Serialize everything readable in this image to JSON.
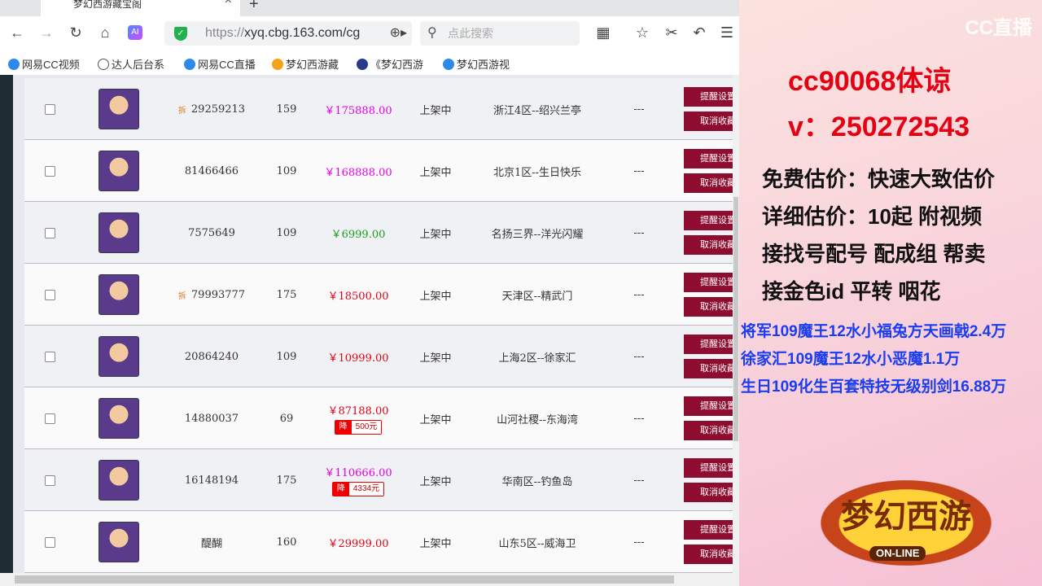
{
  "browser": {
    "tab_title": "梦幻西游藏宝阁",
    "url_prefix": "https://",
    "url_host": "xyq.cbg.163.com/cg",
    "search_placeholder": "点此搜索",
    "bookmarks": [
      "网易CC视频",
      "达人后台系",
      "网易CC直播",
      "梦幻西游藏",
      "《梦幻西游",
      "梦幻西游视"
    ]
  },
  "table": {
    "remind_label": "提醒设置",
    "cancel_label": "取消收藏",
    "drop_label": "降",
    "split_label": "拆",
    "rows": [
      {
        "split": true,
        "id": "29259213",
        "level": "159",
        "price": "￥175888.00",
        "price_color": "#e600e6",
        "status": "上架中",
        "server": "浙江4区--绍兴兰亭",
        "extra": "---"
      },
      {
        "split": false,
        "id": "81466466",
        "level": "109",
        "price": "￥168888.00",
        "price_color": "#e600e6",
        "status": "上架中",
        "server": "北京1区--生日快乐",
        "extra": "---"
      },
      {
        "split": false,
        "id": "7575649",
        "level": "109",
        "price": "￥6999.00",
        "price_color": "#1aa01a",
        "status": "上架中",
        "server": "名扬三界--洋光闪耀",
        "extra": "---"
      },
      {
        "split": true,
        "id": "79993777",
        "level": "175",
        "price": "￥18500.00",
        "price_color": "#e50012",
        "status": "上架中",
        "server": "天津区--精武门",
        "extra": "---"
      },
      {
        "split": false,
        "id": "20864240",
        "level": "109",
        "price": "￥10999.00",
        "price_color": "#e50012",
        "status": "上架中",
        "server": "上海2区--徐家汇",
        "extra": "---"
      },
      {
        "split": false,
        "id": "14880037",
        "level": "69",
        "price": "￥87188.00",
        "price_color": "#e50012",
        "drop": "500元",
        "status": "上架中",
        "server": "山河社稷--东海湾",
        "extra": "---"
      },
      {
        "split": false,
        "id": "16148194",
        "level": "175",
        "price": "￥110666.00",
        "price_color": "#e600e6",
        "drop": "4334元",
        "status": "上架中",
        "server": "华南区--钓鱼岛",
        "extra": "---"
      },
      {
        "split": false,
        "id": "醍醐",
        "level": "160",
        "price": "￥29999.00",
        "price_color": "#e50012",
        "status": "上架中",
        "server": "山东5区--威海卫",
        "extra": "---"
      }
    ]
  },
  "panel": {
    "cc_logo": "CC直播",
    "line1": "cc90068体谅",
    "line2": "v：250272543",
    "services": [
      "免费估价：快速大致估价",
      "详细估价：10起  附视频",
      "接找号配号 配成组 帮卖",
      "接金色id 平转 咽花"
    ],
    "deals": [
      "将军109魔王12水小福兔方天画戟2.4万",
      "徐家汇109魔王12水小恶魔1.1万",
      "生日109化生百套特技无级别剑16.88万"
    ],
    "game_logo": "梦幻西游",
    "game_logo_sub": "ON-LINE"
  }
}
